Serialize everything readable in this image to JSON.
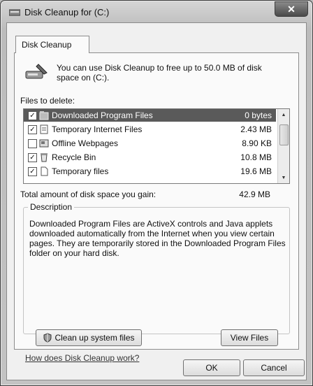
{
  "window": {
    "title": "Disk Cleanup for  (C:)",
    "close_label": "✕",
    "icon": "disk-cleanup-icon"
  },
  "tabs": [
    {
      "label": "Disk Cleanup",
      "selected": true
    }
  ],
  "intro": {
    "text": "You can use Disk Cleanup to free up to 50.0 MB of disk space on  (C:).",
    "icon": "disk-cleanup-drive-icon"
  },
  "files_label": "Files to delete:",
  "files": [
    {
      "checked": true,
      "icon": "downloaded-files-icon",
      "name": "Downloaded Program Files",
      "size": "0 bytes",
      "selected": true
    },
    {
      "checked": true,
      "icon": "internet-files-icon",
      "name": "Temporary Internet Files",
      "size": "2.43 MB",
      "selected": false
    },
    {
      "checked": false,
      "icon": "offline-webpages-icon",
      "name": "Offline Webpages",
      "size": "8.90 KB",
      "selected": false
    },
    {
      "checked": true,
      "icon": "recycle-bin-icon",
      "name": "Recycle Bin",
      "size": "10.8 MB",
      "selected": false
    },
    {
      "checked": true,
      "icon": "temporary-files-icon",
      "name": "Temporary files",
      "size": "19.6 MB",
      "selected": false
    }
  ],
  "total": {
    "label": "Total amount of disk space you gain:",
    "value": "42.9 MB"
  },
  "description": {
    "legend": "Description",
    "text": "Downloaded Program Files are ActiveX controls and Java applets downloaded automatically from the Internet when you view certain pages. They are temporarily stored in the Downloaded Program Files folder on your hard disk."
  },
  "buttons": {
    "cleanup_system": "Clean up system files",
    "view_files": "View Files",
    "ok": "OK",
    "cancel": "Cancel"
  },
  "help_link": "How does Disk Cleanup work?"
}
